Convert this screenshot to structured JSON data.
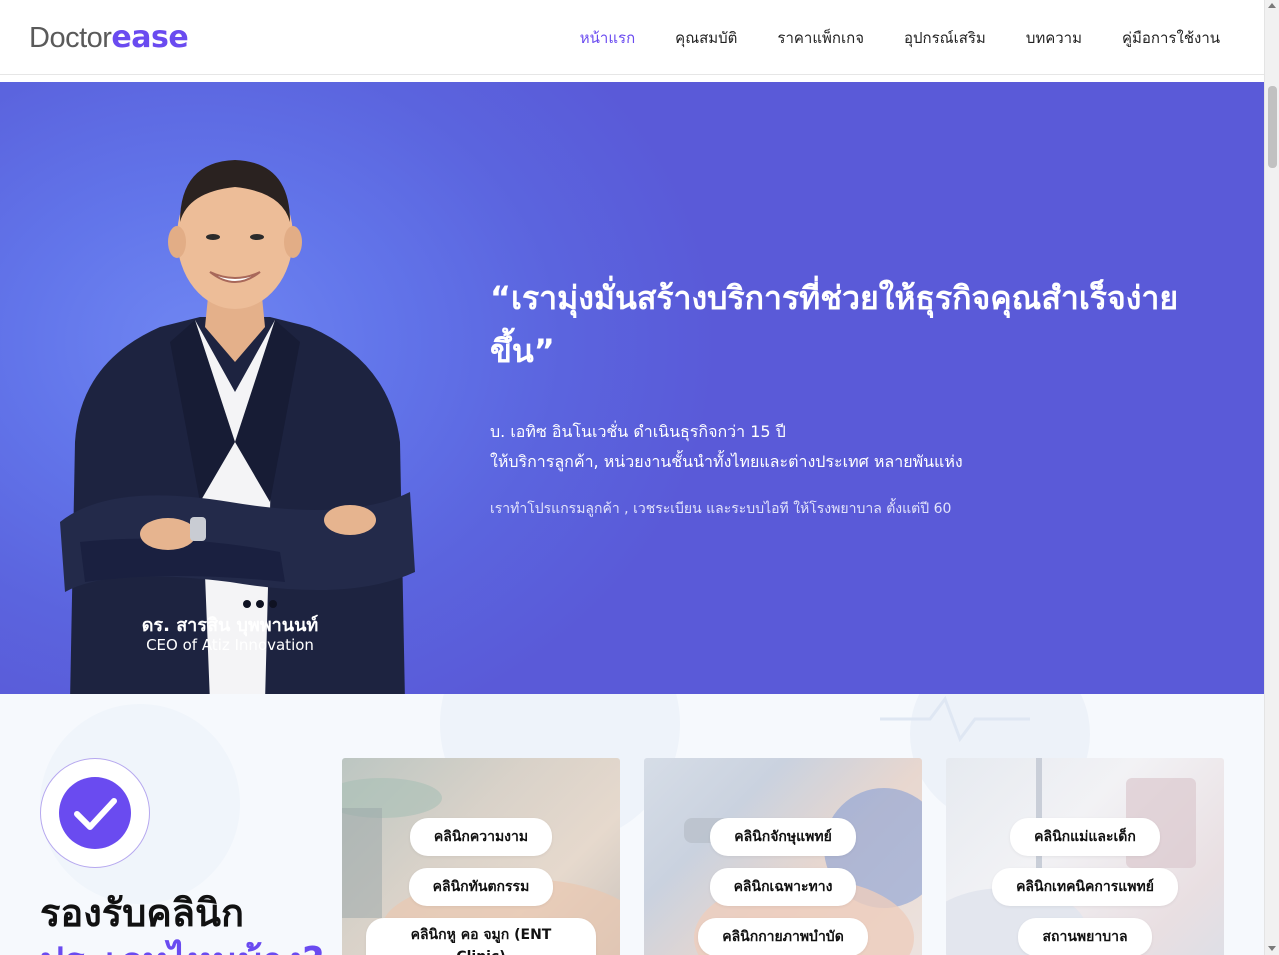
{
  "header": {
    "logo_part1": "Doctor",
    "logo_part2": "ease",
    "nav": [
      {
        "label": "หน้าแรก",
        "active": true
      },
      {
        "label": "คุณสมบัติ"
      },
      {
        "label": "ราคาแพ็กเกจ"
      },
      {
        "label": "อุปกรณ์เสริม"
      },
      {
        "label": "บทความ"
      },
      {
        "label": "คู่มือการใช้งาน"
      }
    ]
  },
  "hero": {
    "quote": "“เรามุ่งมั่นสร้างบริการที่ช่วยให้ธุรกิจคุณสำเร็จง่ายขึ้น”",
    "line1": "บ. เอทิซ อินโนเวชั่น ดำเนินธุรกิจกว่า 15 ปี",
    "line2": "ให้บริการลูกค้า, หน่วยงานชั้นนำทั้งไทยและต่างประเทศ หลายพันแห่ง",
    "sub": "เราทำโปรแกรมลูกค้า , เวชระเบียน และระบบไอที ให้โรงพยาบาล ตั้งแต่ปี 60",
    "ceo_name": "ดร. สารสิน บุพพานนท์",
    "ceo_title": "CEO of Atiz Innovation"
  },
  "clinics": {
    "heading_line1": "รองรับคลินิก",
    "heading_line2": "ประเภทไหนบ้าง?",
    "cards": [
      {
        "items": [
          "คลินิกความงาม",
          "คลินิกทันตกรรม",
          "คลินิกหู คอ จมูก (ENT Clinic)"
        ]
      },
      {
        "items": [
          "คลินิกจักษุแพทย์",
          "คลินิกเฉพาะทาง",
          "คลินิกกายภาพบำบัด"
        ]
      },
      {
        "items": [
          "คลินิกแม่และเด็ก",
          "คลินิกเทคนิคการแพทย์",
          "สถานพยาบาล"
        ]
      }
    ]
  },
  "colors": {
    "accent": "#6a4bf0",
    "hero_bg": "#5b64de"
  }
}
